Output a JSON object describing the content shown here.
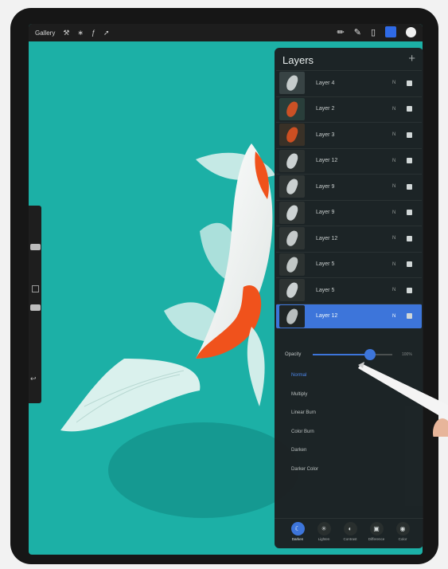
{
  "toolbar": {
    "gallery_label": "Gallery",
    "left_tools": [
      "wrench-icon",
      "magic-wand-icon",
      "selection-icon",
      "transform-icon"
    ],
    "right_tools": [
      "brush-icon",
      "smudge-icon",
      "eraser-icon",
      "layers-icon",
      "color-icon"
    ]
  },
  "layers_panel": {
    "title": "Layers",
    "add_label": "+",
    "layers": [
      {
        "name": "Layer 4",
        "blend": "N",
        "visible": true,
        "selected": false
      },
      {
        "name": "Layer 2",
        "blend": "N",
        "visible": true,
        "selected": false
      },
      {
        "name": "Layer 3",
        "blend": "N",
        "visible": true,
        "selected": false
      },
      {
        "name": "Layer 12",
        "blend": "N",
        "visible": true,
        "selected": false
      },
      {
        "name": "Layer 9",
        "blend": "N",
        "visible": true,
        "selected": false
      },
      {
        "name": "Layer 9",
        "blend": "N",
        "visible": true,
        "selected": false
      },
      {
        "name": "Layer 12",
        "blend": "N",
        "visible": true,
        "selected": false
      },
      {
        "name": "Layer 5",
        "blend": "N",
        "visible": true,
        "selected": false
      },
      {
        "name": "Layer 5",
        "blend": "N",
        "visible": true,
        "selected": false
      },
      {
        "name": "Layer 12",
        "blend": "N",
        "visible": true,
        "selected": true
      }
    ],
    "opacity": {
      "label": "Opacity",
      "value_text": "100%",
      "level": 0.72
    },
    "blend_modes": [
      "Normal",
      "Multiply",
      "Linear Burn",
      "Color Burn",
      "Darken",
      "Darker Color"
    ],
    "active_blend": "Normal",
    "mode_groups": [
      {
        "label": "Darken",
        "active": true
      },
      {
        "label": "Lighten",
        "active": false
      },
      {
        "label": "Contrast",
        "active": false
      },
      {
        "label": "Difference",
        "active": false
      },
      {
        "label": "Color",
        "active": false
      }
    ]
  },
  "colors": {
    "canvas": "#1cb0a6",
    "accent": "#3f73dd",
    "panel": "#1d1f21"
  }
}
